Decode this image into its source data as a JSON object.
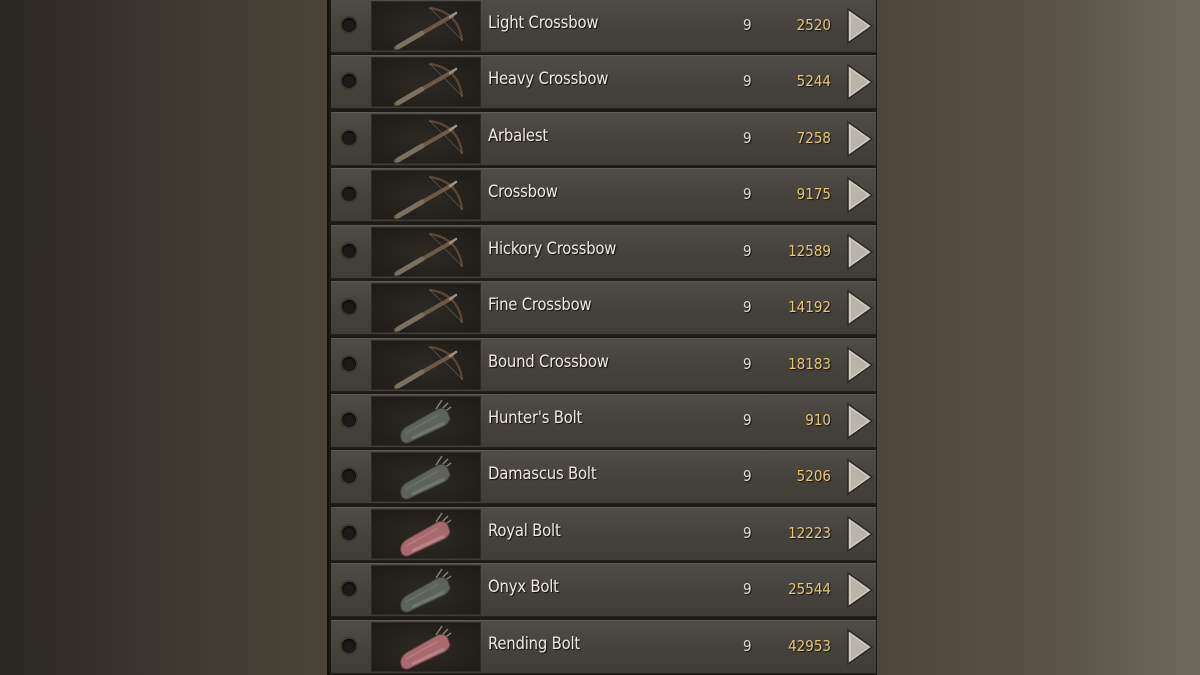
{
  "colors": {
    "price": "#e6c774",
    "name": "#efe9dc",
    "row_bg": "#48453f"
  },
  "items": [
    {
      "name": "Light Crossbow",
      "tier": "9",
      "price": "2520",
      "icon": "crossbow-icon",
      "kind": "crossbow"
    },
    {
      "name": "Heavy Crossbow",
      "tier": "9",
      "price": "5244",
      "icon": "crossbow-icon",
      "kind": "crossbow"
    },
    {
      "name": "Arbalest",
      "tier": "9",
      "price": "7258",
      "icon": "crossbow-icon",
      "kind": "crossbow"
    },
    {
      "name": "Crossbow",
      "tier": "9",
      "price": "9175",
      "icon": "crossbow-icon",
      "kind": "crossbow"
    },
    {
      "name": "Hickory Crossbow",
      "tier": "9",
      "price": "12589",
      "icon": "crossbow-icon",
      "kind": "crossbow"
    },
    {
      "name": "Fine Crossbow",
      "tier": "9",
      "price": "14192",
      "icon": "crossbow-icon",
      "kind": "crossbow"
    },
    {
      "name": "Bound Crossbow",
      "tier": "9",
      "price": "18183",
      "icon": "crossbow-icon",
      "kind": "crossbow"
    },
    {
      "name": "Hunter's Bolt",
      "tier": "9",
      "price": "910",
      "icon": "bolt-quiver-icon",
      "kind": "quiver-grey"
    },
    {
      "name": "Damascus Bolt",
      "tier": "9",
      "price": "5206",
      "icon": "bolt-quiver-icon",
      "kind": "quiver-grey"
    },
    {
      "name": "Royal Bolt",
      "tier": "9",
      "price": "12223",
      "icon": "bolt-quiver-icon",
      "kind": "quiver-red"
    },
    {
      "name": "Onyx Bolt",
      "tier": "9",
      "price": "25544",
      "icon": "bolt-quiver-icon",
      "kind": "quiver-grey"
    },
    {
      "name": "Rending Bolt",
      "tier": "9",
      "price": "42953",
      "icon": "bolt-quiver-icon",
      "kind": "quiver-red"
    }
  ]
}
